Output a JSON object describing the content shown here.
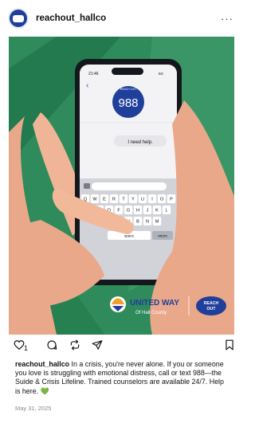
{
  "post": {
    "username": "reachout_hallco",
    "more_label": "···",
    "likes_count": "1",
    "caption_user": "reachout_hallco",
    "caption_text": "In a crisis, you're never alone. If you or someone you love is struggling with emotional distress, call or text 988—the Suide & Crisis Lifeline. Trained counselors are available 24/7. Help is here. 💚",
    "date": "May 31, 2025"
  },
  "image": {
    "phone_time": "21:46",
    "phone_signal": "5G",
    "badge_top": "REACH OUT",
    "badge_number": "988",
    "message_text": "I need help.",
    "keyboard_rows": [
      [
        "Q",
        "W",
        "E",
        "R",
        "T",
        "Y",
        "U",
        "I",
        "O",
        "P"
      ],
      [
        "A",
        "S",
        "D",
        "F",
        "G",
        "H",
        "J",
        "K",
        "L"
      ],
      [
        "Z",
        "X",
        "C",
        "V",
        "B",
        "N",
        "M"
      ]
    ],
    "space_label": "space",
    "return_label": "return",
    "brand_line1": "UNITED WAY",
    "brand_line2": "Of Hall County",
    "reach_line1": "REACH",
    "reach_line2": "OUT"
  },
  "colors": {
    "background_green": "#2f8a5c",
    "accent_blue": "#1f3f9a",
    "heart_green": "#55b33a"
  }
}
